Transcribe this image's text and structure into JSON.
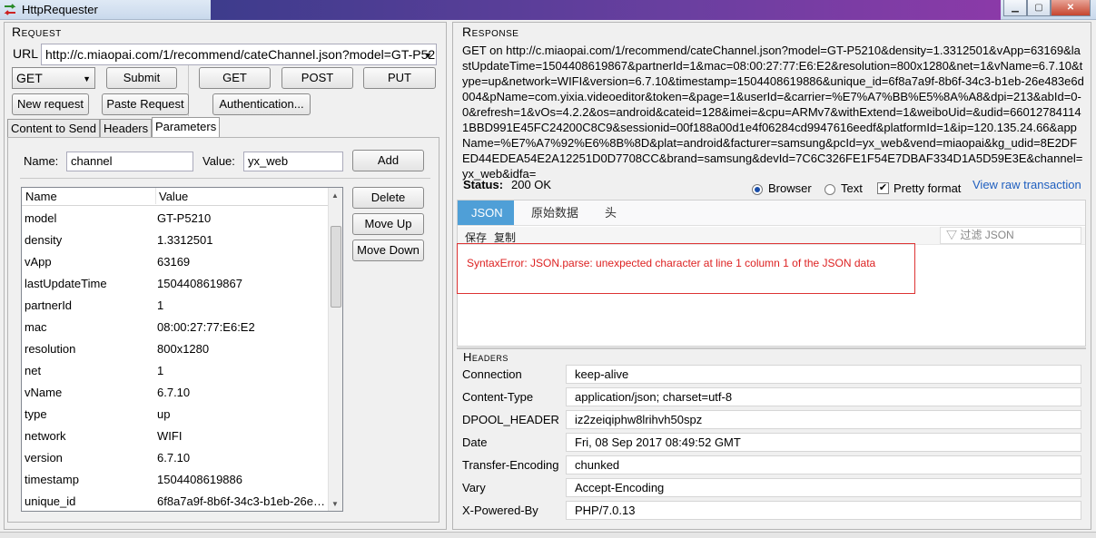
{
  "window": {
    "title": "HttpRequester"
  },
  "request": {
    "section_title": "Request",
    "url_label": "URL",
    "url_value": "http://c.miaopai.com/1/recommend/cateChannel.json?model=GT-P5210",
    "method_value": "GET",
    "buttons": {
      "submit": "Submit",
      "get": "GET",
      "post": "POST",
      "put": "PUT",
      "new_request": "New request",
      "paste_request": "Paste Request",
      "authentication": "Authentication..."
    },
    "tabs": [
      "Content to Send",
      "Headers",
      "Parameters"
    ],
    "param_name_label": "Name:",
    "param_name_value": "channel",
    "param_value_label": "Value:",
    "param_value_value": "yx_web",
    "add_label": "Add",
    "delete_label": "Delete",
    "move_up_label": "Move Up",
    "move_down_label": "Move Down",
    "table": {
      "col_name": "Name",
      "col_value": "Value",
      "rows": [
        {
          "name": "model",
          "value": "GT-P5210"
        },
        {
          "name": "density",
          "value": "1.3312501"
        },
        {
          "name": "vApp",
          "value": "63169"
        },
        {
          "name": "lastUpdateTime",
          "value": "1504408619867"
        },
        {
          "name": "partnerId",
          "value": "1"
        },
        {
          "name": "mac",
          "value": "08:00:27:77:E6:E2"
        },
        {
          "name": "resolution",
          "value": "800x1280"
        },
        {
          "name": "net",
          "value": "1"
        },
        {
          "name": "vName",
          "value": "6.7.10"
        },
        {
          "name": "type",
          "value": "up"
        },
        {
          "name": "network",
          "value": "WIFI"
        },
        {
          "name": "version",
          "value": "6.7.10"
        },
        {
          "name": "timestamp",
          "value": "1504408619886"
        },
        {
          "name": "unique_id",
          "value": "6f8a7a9f-8b6f-34c3-b1eb-26e4..."
        }
      ]
    }
  },
  "response": {
    "section_title": "Response",
    "request_line": "GET on http://c.miaopai.com/1/recommend/cateChannel.json?model=GT-P5210&density=1.3312501&vApp=63169&lastUpdateTime=1504408619867&partnerId=1&mac=08:00:27:77:E6:E2&resolution=800x1280&net=1&vName=6.7.10&type=up&network=WIFI&version=6.7.10&timestamp=1504408619886&unique_id=6f8a7a9f-8b6f-34c3-b1eb-26e483e6d004&pName=com.yixia.videoeditor&token=&page=1&userId=&carrier=%E7%A7%BB%E5%8A%A8&dpi=213&abId=0-0&refresh=1&vOs=4.2.2&os=android&cateid=128&imei=&cpu=ARMv7&withExtend=1&weiboUid=&udid=660127841141BBD991E45FC24200C8C9&sessionid=00f188a00d1e4f06284cd9947616eedf&platformId=1&ip=120.135.24.66&appName=%E7%A7%92%E6%8B%8D&plat=android&facturer=samsung&pcId=yx_web&vend=miaopai&kg_udid=8E2DFED44EDEA54E2A12251D0D7708CC&brand=samsung&devId=7C6C326FE1F54E7DBAF334D1A5D59E3E&channel=yx_web&idfa=",
    "status_label": "Status:",
    "status_value": "200 OK",
    "view_options": {
      "browser": "Browser",
      "text": "Text",
      "pretty": "Pretty format"
    },
    "view_raw_link": "View raw transaction",
    "viewer_tabs": [
      "JSON",
      "原始数据",
      "头"
    ],
    "toolbar": {
      "save": "保存",
      "copy": "复制",
      "filter_placeholder": "过滤 JSON"
    },
    "error_text": "SyntaxError: JSON.parse: unexpected character at line 1 column 1 of the JSON data",
    "headers_title": "Headers",
    "headers": [
      {
        "key": "Connection",
        "value": "keep-alive"
      },
      {
        "key": "Content-Type",
        "value": "application/json; charset=utf-8"
      },
      {
        "key": "DPOOL_HEADER",
        "value": "iz2zeiqiphw8lrihvh50spz"
      },
      {
        "key": "Date",
        "value": "Fri, 08 Sep 2017 08:49:52 GMT"
      },
      {
        "key": "Transfer-Encoding",
        "value": "chunked"
      },
      {
        "key": "Vary",
        "value": "Accept-Encoding"
      },
      {
        "key": "X-Powered-By",
        "value": "PHP/7.0.13"
      }
    ]
  }
}
